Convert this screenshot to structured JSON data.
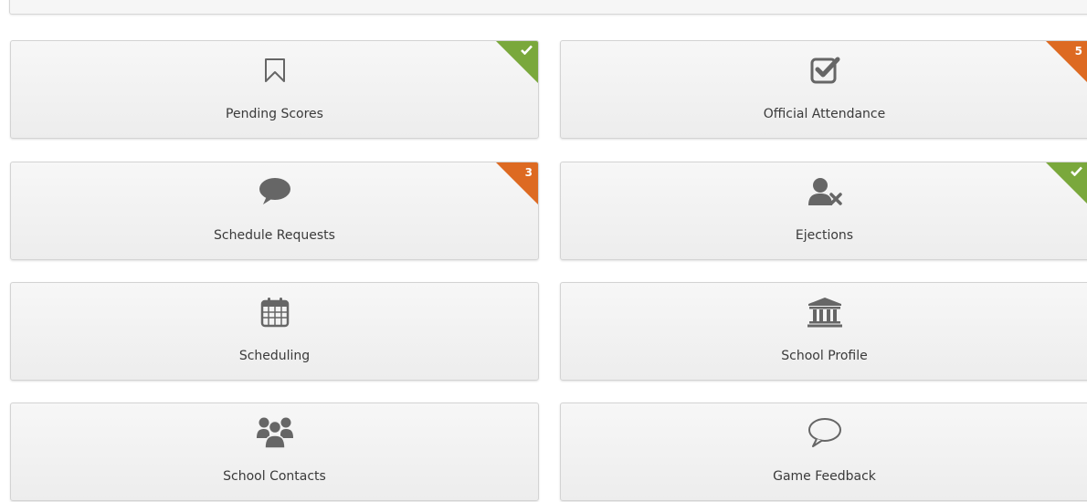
{
  "tiles": [
    {
      "label": "Pending Scores",
      "icon": "bookmark-icon",
      "badge": "check"
    },
    {
      "label": "Official Attendance",
      "icon": "checkbox-icon",
      "badge": "5"
    },
    {
      "label": "Schedule Requests",
      "icon": "speech-bubble-icon",
      "badge": "3"
    },
    {
      "label": "Ejections",
      "icon": "user-remove-icon",
      "badge": "check"
    },
    {
      "label": "Scheduling",
      "icon": "calendar-icon",
      "badge": null
    },
    {
      "label": "School Profile",
      "icon": "institution-icon",
      "badge": null
    },
    {
      "label": "School Contacts",
      "icon": "users-group-icon",
      "badge": null
    },
    {
      "label": "Game Feedback",
      "icon": "speech-bubble-outline-icon",
      "badge": null
    }
  ],
  "colors": {
    "check_badge": "#7aa83c",
    "count_badge": "#dd6a22",
    "icon": "#666666",
    "label": "#3a3a3a"
  }
}
